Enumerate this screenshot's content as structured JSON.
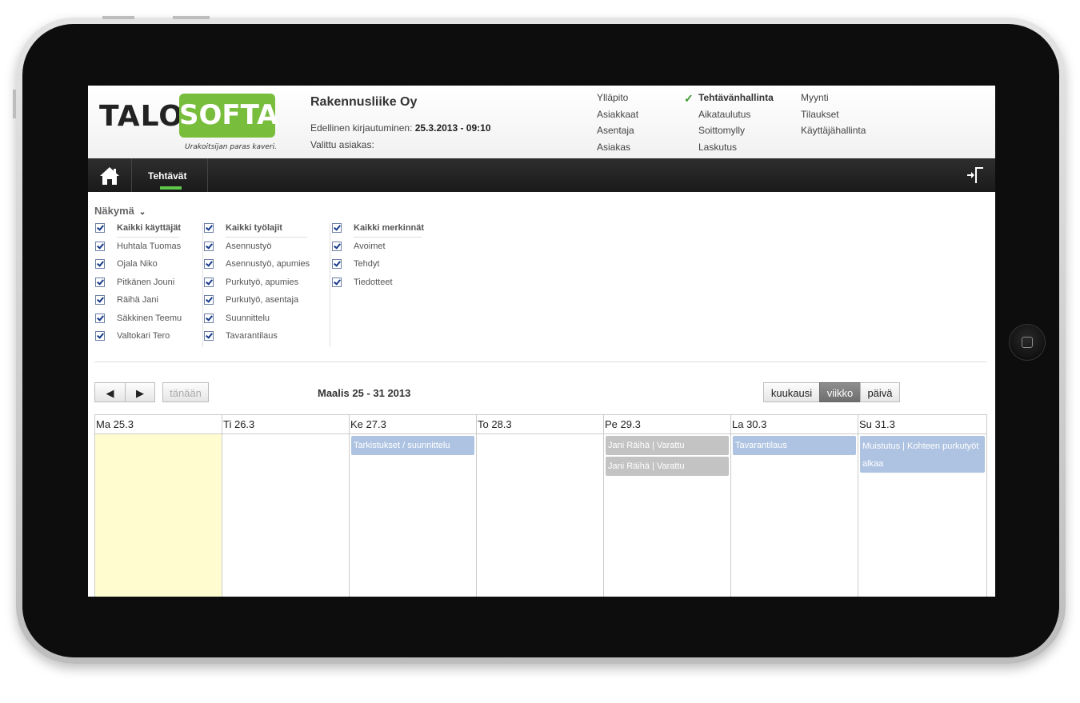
{
  "header": {
    "logo_part1": "TALO",
    "logo_part2": "SOFTA",
    "logo_tagline": "Urakoitsijan paras kaveri.",
    "company": "Rakennusliike Oy",
    "last_login_label": "Edellinen kirjautuminen: ",
    "last_login_value": "25.3.2013 - 09:10",
    "selected_customer_label": "Valittu asiakas:",
    "menu": {
      "col1": [
        "Ylläpito",
        "Asiakkaat",
        "Asentaja",
        "Asiakas"
      ],
      "col2": [
        "Tehtävänhallinta",
        "Aikataulutus",
        "Soittomylly",
        "Laskutus"
      ],
      "col3": [
        "Myynti",
        "Tilaukset",
        "Käyttäjähallinta"
      ],
      "active": "Tehtävänhallinta"
    }
  },
  "nav": {
    "tab_label": "Tehtävät",
    "accent": "#5fc84a"
  },
  "filters": {
    "view_label": "Näkymä",
    "users": {
      "header": "Kaikki käyttäjät",
      "items": [
        "Huhtala Tuomas",
        "Ojala Niko",
        "Pitkänen Jouni",
        "Räihä Jani",
        "Säkkinen Teemu",
        "Valtokari Tero"
      ]
    },
    "work_types": {
      "header": "Kaikki työlajit",
      "items": [
        "Asennustyö",
        "Asennustyö, apumies",
        "Purkutyö, apumies",
        "Purkutyö, asentaja",
        "Suunnittelu",
        "Tavarantilaus"
      ]
    },
    "entries": {
      "header": "Kaikki merkinnät",
      "items": [
        "Avoimet",
        "Tehdyt",
        "Tiedotteet"
      ]
    }
  },
  "calendar": {
    "prev_label": "◀",
    "next_label": "▶",
    "today_label": "tänään",
    "title": "Maalis 25 - 31 2013",
    "views": {
      "month": "kuukausi",
      "week": "viikko",
      "day": "päivä",
      "selected": "viikko"
    },
    "days": [
      {
        "label": "Ma 25.3",
        "today": true,
        "events": []
      },
      {
        "label": "Ti 26.3",
        "events": []
      },
      {
        "label": "Ke 27.3",
        "events": [
          {
            "text": "Tarkistukset / suunnittelu",
            "color": "blue"
          }
        ]
      },
      {
        "label": "To 28.3",
        "events": []
      },
      {
        "label": "Pe 29.3",
        "events": [
          {
            "text": "Jani Räihä | Varattu",
            "color": "gray"
          },
          {
            "text": "Jani Räihä | Varattu",
            "color": "gray"
          }
        ]
      },
      {
        "label": "La 30.3",
        "events": [
          {
            "text": "Tavarantilaus",
            "color": "blue"
          }
        ]
      },
      {
        "label": "Su 31.3",
        "events": [
          {
            "text": "Muistutus | Kohteen purkutyöt alkaa",
            "color": "blue"
          }
        ]
      }
    ]
  },
  "icons": {
    "home": "home-icon",
    "exit": "logout-icon",
    "check": "checkmark-icon"
  },
  "colors": {
    "brand_green": "#78bd3c",
    "event_blue": "#aec3e1",
    "event_gray": "#c3c3c3",
    "today_bg": "#fffdd0"
  }
}
